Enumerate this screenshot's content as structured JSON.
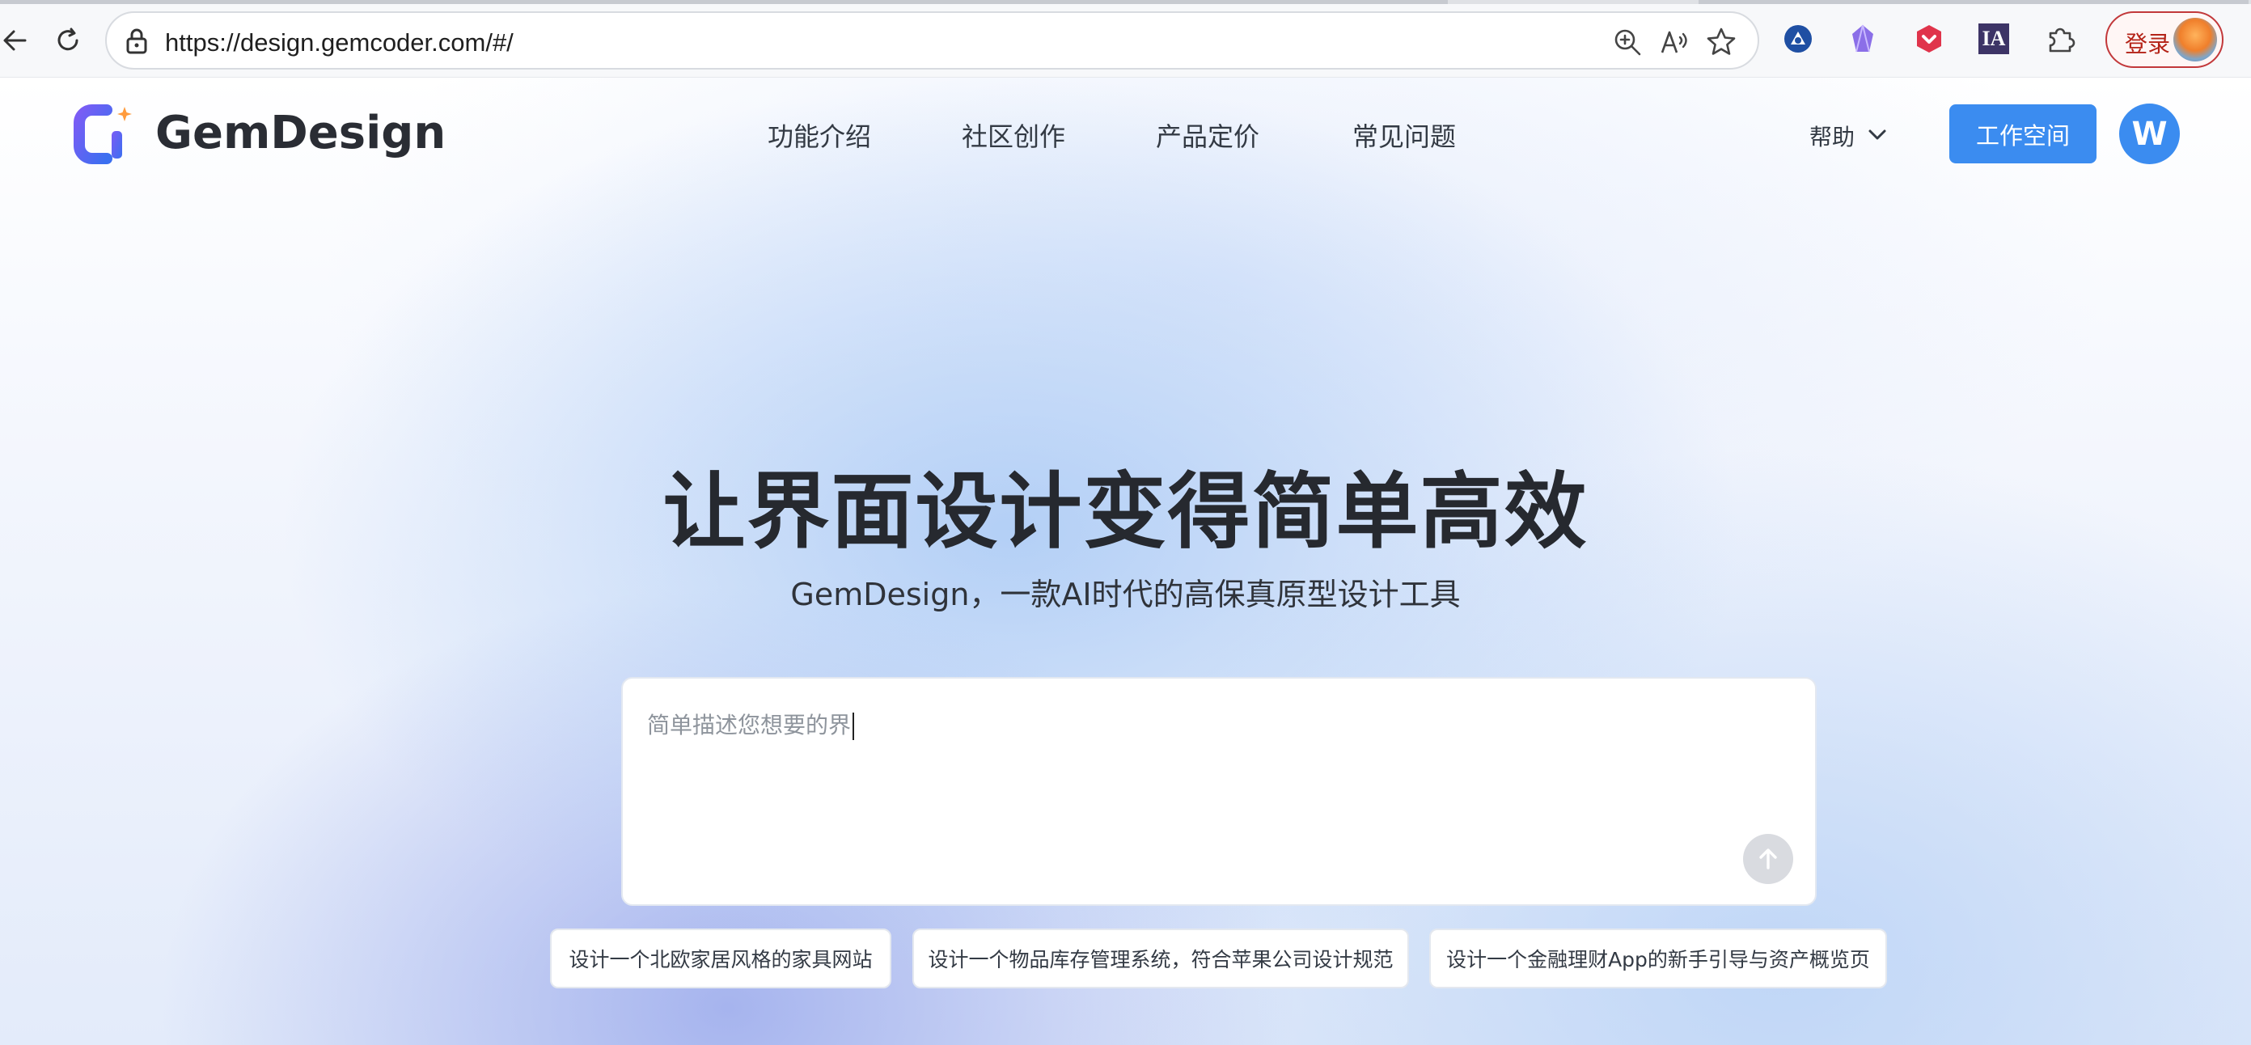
{
  "browser": {
    "url": "https://design.gemcoder.com/#/",
    "login_label": "登录",
    "extensions": [
      "blue-circle-icon",
      "purple-crystal-icon",
      "red-shield-icon",
      "ia-icon",
      "puzzle-icon"
    ],
    "ia_label": "IA"
  },
  "header": {
    "brand": "GemDesign",
    "nav": [
      "功能介绍",
      "社区创作",
      "产品定价",
      "常见问题"
    ],
    "help_label": "帮助",
    "workspace_label": "工作空间",
    "avatar_letter": "W"
  },
  "hero": {
    "title": "让界面设计变得简单高效",
    "subtitle": "GemDesign，一款AI时代的高保真原型设计工具"
  },
  "prompt": {
    "value": "简单描述您想要的界"
  },
  "suggestions": [
    "设计一个北欧家居风格的家具网站",
    "设计一个物品库存管理系统，符合苹果公司设计规范",
    "设计一个金融理财App的新手引导与资产概览页"
  ],
  "colors": {
    "accent": "#3b8cf0",
    "title_text": "#26292f",
    "login_red": "#b42318"
  }
}
